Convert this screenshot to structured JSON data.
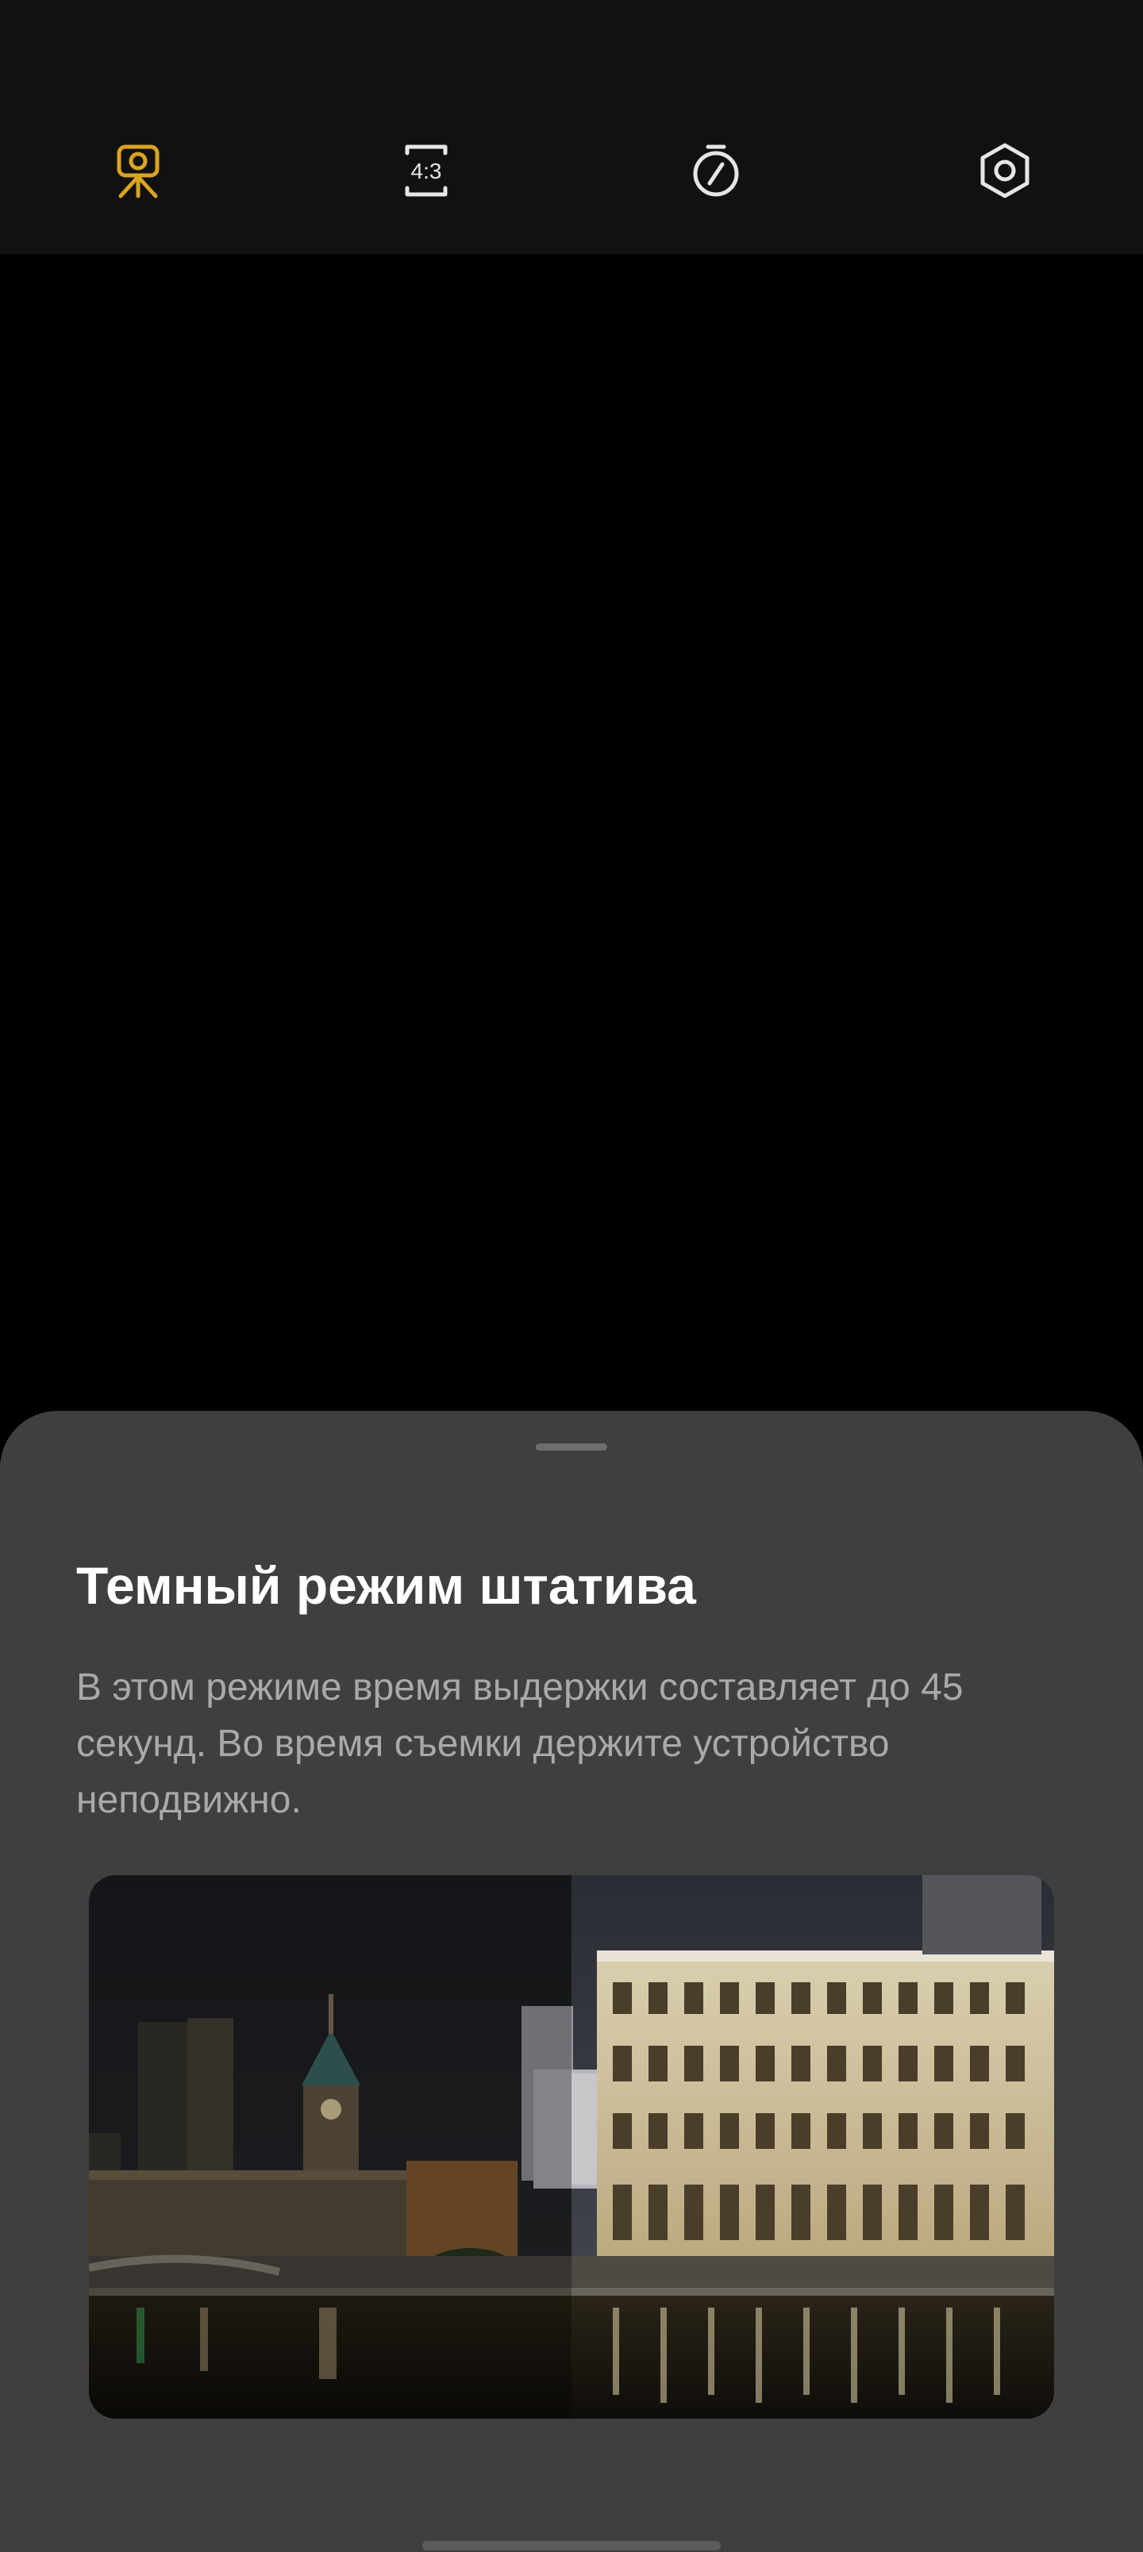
{
  "toolbar": {
    "buttons": [
      {
        "icon": "tripod-icon",
        "active": true,
        "color": "#D9A521"
      },
      {
        "icon": "aspect-ratio-icon",
        "label": "4:3",
        "active": false,
        "color": "#E6E6E6"
      },
      {
        "icon": "timer-icon",
        "active": false,
        "color": "#E6E6E6"
      },
      {
        "icon": "settings-hexagon-icon",
        "active": false,
        "color": "#E6E6E6"
      }
    ]
  },
  "sheet": {
    "title": "Темный режим штатива",
    "description": "В этом режиме время выдержки составляет до 45 секунд. Во время съемки держите устройство неподвижно."
  },
  "colors": {
    "accent": "#D9A521",
    "toolbar_bg": "#111111",
    "sheet_bg": "#3F3F3F",
    "title": "#FFFFFF",
    "description": "#A9A9A9"
  }
}
